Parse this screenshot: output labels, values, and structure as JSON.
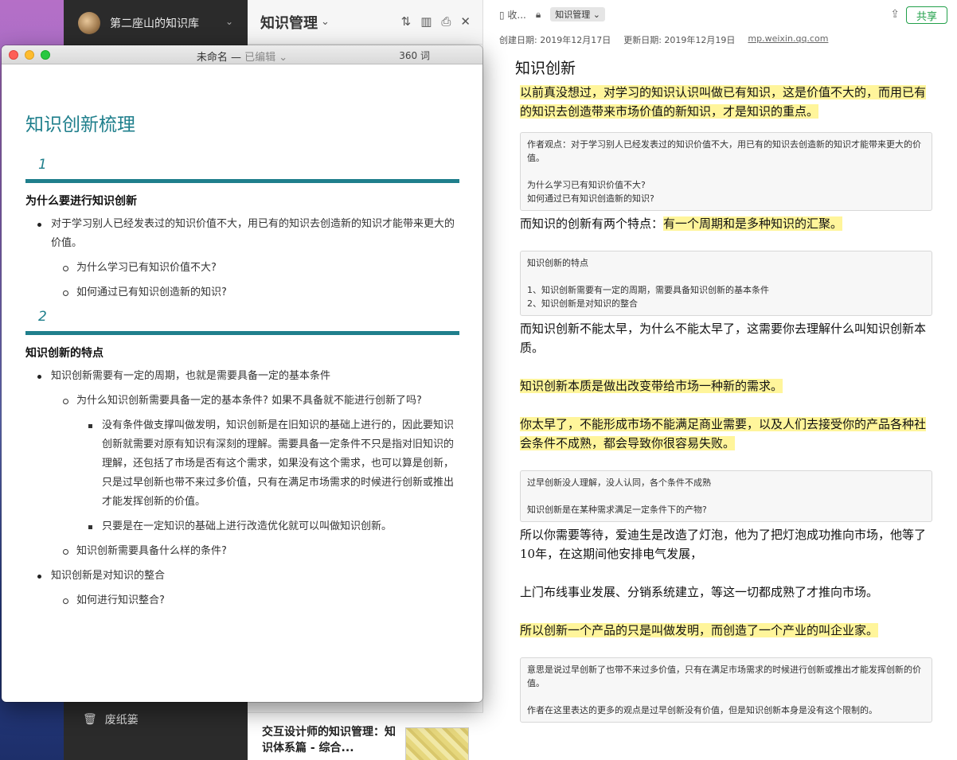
{
  "sidebar": {
    "notebook_name": "第二座山的知识库",
    "partial_item": "…",
    "trash_label": "废纸篓"
  },
  "notelist": {
    "title": "知识管理",
    "peek_text": "——",
    "card_title": "交互设计师的知识管理：知识体系篇 - 综合..."
  },
  "noteview": {
    "collect_label": "收...",
    "notebook_chip": "知识管理",
    "share_label": "共享",
    "created": "创建日期: 2019年12月17日",
    "updated": "更新日期: 2019年12月19日",
    "source": "mp.weixin.qq.com",
    "heading": "知识创新",
    "p1": "以前真没想过，对学习的知识认识叫做已有知识，这是价值不大的，而用已有的知识去创造带来市场价值的新知识，才是知识的重点。",
    "box1_l1": "作者观点：对于学习别人已经发表过的知识价值不大，用已有的知识去创造新的知识才能带来更大的价值。",
    "box1_l2": "为什么学习已有知识价值不大?",
    "box1_l3": "如何通过已有知识创造新的知识?",
    "p2_plain": "而知识的创新有两个特点：",
    "p2_hl": "有一个周期和是多种知识的汇聚。",
    "box2_l1": "知识创新的特点",
    "box2_l2": "1、知识创新需要有一定的周期，需要具备知识创新的基本条件",
    "box2_l3": "2、知识创新是对知识的整合",
    "p3": "而知识创新不能太早，为什么不能太早了，这需要你去理解什么叫知识创新本质。",
    "p4": "知识创新本质是做出改变带给市场一种新的需求。",
    "p5": "你太早了，不能形成市场不能满足商业需要，以及人们去接受你的产品各种社会条件不成熟，都会导致你很容易失败。",
    "box3_l1": "过早创新没人理解，没人认同，各个条件不成熟",
    "box3_l2": "知识创新是在某种需求满足一定条件下的产物?",
    "p6": "所以你需要等待，爱迪生是改造了灯泡，他为了把灯泡成功推向市场，他等了10年，在这期间他安排电气发展，",
    "p7": "上门布线事业发展、分销系统建立，等这一切都成熟了才推向市场。",
    "p8": "所以创新一个产品的只是叫做发明，而创造了一个产业的叫企业家。",
    "box4_l1": "意思是说过早创新了也带不来过多价值，只有在满足市场需求的时候进行创新或推出才能发挥创新的价值。",
    "box4_l2": "作者在这里表达的更多的观点是过早创新没有价值，但是知识创新本身是没有这个限制的。"
  },
  "editor": {
    "window_title": "未命名 — ",
    "edited": "已编辑 ⌄",
    "word_count": "360 词",
    "doc_title": "知识创新梳理",
    "sec1_num": "1",
    "sec1_heading": "为什么要进行知识创新",
    "sec1_b1": "对于学习别人已经发表过的知识价值不大，用已有的知识去创造新的知识才能带来更大的价值。",
    "sec1_b1a": "为什么学习已有知识价值不大?",
    "sec1_b1b": "如何通过已有知识创造新的知识?",
    "sec2_num": "2",
    "sec2_heading": "知识创新的特点",
    "sec2_b1": "知识创新需要有一定的周期，也就是需要具备一定的基本条件",
    "sec2_b1a": "为什么知识创新需要具备一定的基本条件? 如果不具备就不能进行创新了吗?",
    "sec2_b1a1": "没有条件做支撑叫做发明，知识创新是在旧知识的基础上进行的，因此要知识创新就需要对原有知识有深刻的理解。需要具备一定条件不只是指对旧知识的理解，还包括了市场是否有这个需求，如果没有这个需求，也可以算是创新，只是过早创新也带不来过多价值，只有在满足市场需求的时候进行创新或推出才能发挥创新的价值。",
    "sec2_b1a2": "只要是在一定知识的基础上进行改造优化就可以叫做知识创新。",
    "sec2_b1b": "知识创新需要具备什么样的条件?",
    "sec2_b2": "知识创新是对知识的整合",
    "sec2_b2a": "如何进行知识整合?"
  }
}
